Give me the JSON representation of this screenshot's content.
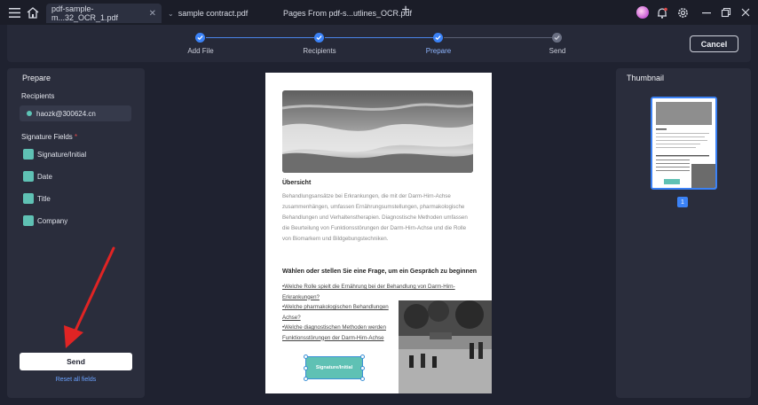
{
  "titlebar": {
    "tabs": [
      {
        "label": "pdf-sample-m...32_OCR_1.pdf",
        "active": true
      },
      {
        "label": "sample contract.pdf",
        "active": false
      },
      {
        "label": "Pages From pdf-s...utlines_OCR.pdf",
        "active": false
      }
    ],
    "icons": [
      "menu-icon",
      "home-icon",
      "close-icon",
      "chevron-down-icon",
      "plus-icon",
      "bell-icon",
      "gear-icon",
      "minimize-icon",
      "restore-icon",
      "close-window-icon"
    ]
  },
  "stepper": {
    "steps": [
      {
        "label": "Add File",
        "state": "done"
      },
      {
        "label": "Recipients",
        "state": "done"
      },
      {
        "label": "Prepare",
        "state": "active"
      },
      {
        "label": "Send",
        "state": "pending"
      }
    ],
    "cancel_label": "Cancel"
  },
  "left_panel": {
    "title": "Prepare",
    "recipients_label": "Recipients",
    "recipient_email": "haozk@300624.cn",
    "signature_fields_label": "Signature Fields",
    "required_mark": "*",
    "fields": [
      "Signature/Initial",
      "Date",
      "Title",
      "Company"
    ],
    "send_label": "Send",
    "reset_label": "Reset all fields"
  },
  "document": {
    "heading": "Übersicht",
    "paragraph": "Behandlungsansätze bei Erkrankungen, die mit der Darm-Hirn-Achse zusammenhängen, umfassen Ernährungsumstellungen, pharmakologische Behandlungen und Verhaltenstherapien. Diagnostische Methoden umfassen die Beurteilung von Funktionsstörungen der Darm-Hirn-Achse und die Rolle von Biomarkern und Bildgebungstechniken.",
    "question_heading": "Wählen oder stellen Sie eine Frage, um ein Gespräch zu beginnen",
    "questions": [
      "•Welche Rolle spielt die Ernährung bei der Behandlung von Darm-Hirn-Erkrankungen?",
      "•Welche pharmakologischen Behandlungen Achse?",
      "•Welche diagnostischen Methoden werden Funktionsstörungen der Darm-Hirn-Achse"
    ],
    "signature_field_label": "Signature/Initial"
  },
  "right_panel": {
    "title": "Thumbnail",
    "page_number": "1"
  },
  "colors": {
    "accent": "#3b82f6",
    "field": "#5fc1b4",
    "arrow": "#e02424"
  }
}
